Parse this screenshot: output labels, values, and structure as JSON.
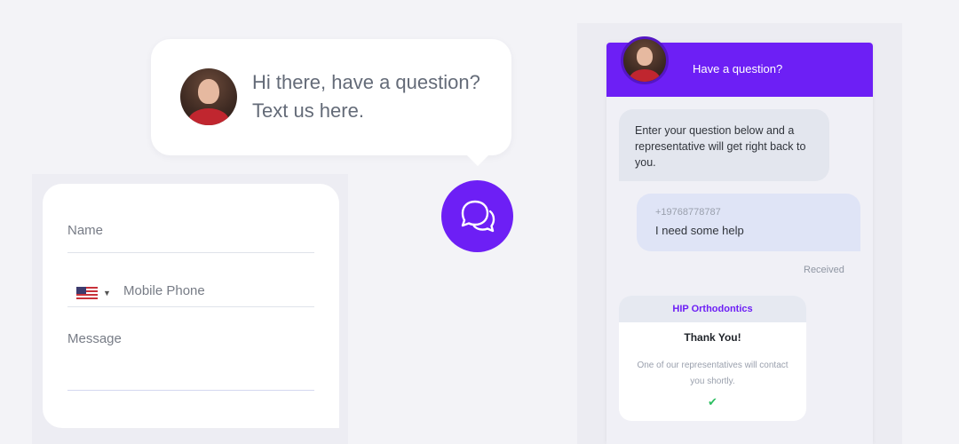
{
  "greeting": {
    "text": "Hi there, have a question? Text us here."
  },
  "form": {
    "name_placeholder": "Name",
    "phone_placeholder": "Mobile Phone",
    "country_flag": "us-flag-icon",
    "message_placeholder": "Message"
  },
  "chat": {
    "header_title": "Have a question?",
    "accent_color": "#6d1ff5",
    "intro_message": "Enter your question below and a representative will get right back to you.",
    "outgoing": {
      "phone": "+19768778787",
      "text": "I need some help"
    },
    "status": "Received",
    "confirmation": {
      "company": "HIP Orthodontics",
      "title": "Thank You!",
      "body": "One of our representatives will contact you shortly.",
      "icon": "check-icon"
    }
  }
}
